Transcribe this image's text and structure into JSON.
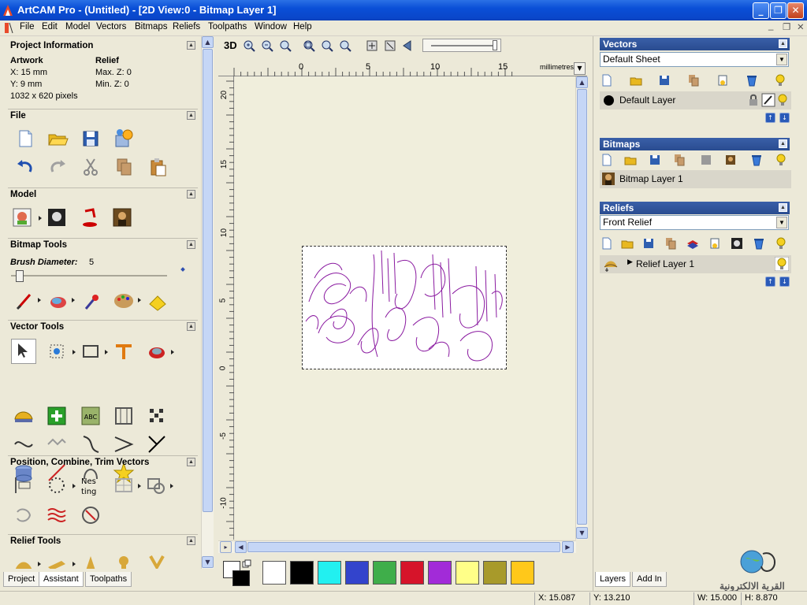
{
  "window": {
    "title": "ArtCAM Pro - (Untitled) - [2D View:0 - Bitmap Layer 1]"
  },
  "menu": [
    "File",
    "Edit",
    "Model",
    "Vectors",
    "Bitmaps",
    "Reliefs",
    "Toolpaths",
    "Window",
    "Help"
  ],
  "project_info": {
    "header": "Project Information",
    "artwork_label": "Artwork",
    "relief_label": "Relief",
    "x": "X: 15 mm",
    "y": "Y: 9 mm",
    "pixels": "1032 x 620 pixels",
    "max_z": "Max. Z: 0",
    "min_z": "Min. Z: 0"
  },
  "sections": {
    "file": "File",
    "model": "Model",
    "bitmap_tools": "Bitmap Tools",
    "vector_tools": "Vector Tools",
    "position": "Position, Combine, Trim Vectors",
    "relief_tools": "Relief Tools"
  },
  "bitmap_tools": {
    "brush_label": "Brush Diameter:",
    "brush_value": "5"
  },
  "left_tabs": [
    "Project",
    "Assistant",
    "Toolpaths"
  ],
  "view_toolbar": {
    "label_3d": "3D"
  },
  "ruler": {
    "unit": "millimetres",
    "x_ticks": [
      "0",
      "5",
      "10",
      "15"
    ],
    "y_ticks": [
      "20",
      "15",
      "10",
      "5",
      "0",
      "-5",
      "-10"
    ]
  },
  "vectors_panel": {
    "header": "Vectors",
    "sheet": "Default Sheet",
    "layer": "Default Layer"
  },
  "bitmaps_panel": {
    "header": "Bitmaps",
    "layer": "Bitmap Layer 1"
  },
  "reliefs_panel": {
    "header": "Reliefs",
    "combo": "Front Relief",
    "layer": "Relief Layer 1"
  },
  "right_tabs": [
    "Layers",
    "Add In"
  ],
  "palette": [
    "#ffffff",
    "#000000",
    "#22f0f0",
    "#3344cc",
    "#3fae4a",
    "#d6142a",
    "#a22bd8",
    "#ffff88",
    "#a89a2a",
    "#ffc81a"
  ],
  "status": {
    "x": "X: 15.087",
    "y": "Y: 13.210",
    "w": "W: 15.000",
    "h": "H: 8.870"
  },
  "watermark": "القرية الالكترونية",
  "colors": {
    "titlebar": "#0a4fd7",
    "canvas_bg": "#f0eedc",
    "panel_head": "#2a4c90",
    "artwork_stroke": "#8a1aa0"
  }
}
